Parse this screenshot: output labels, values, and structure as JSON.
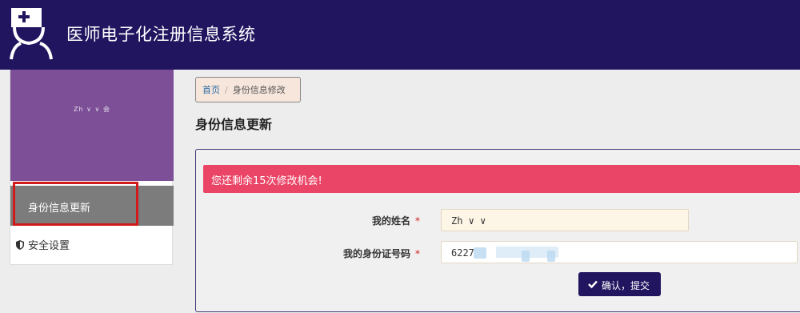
{
  "header": {
    "title": "医师电子化注册信息系统"
  },
  "sidebar": {
    "username": "Zh  ∨ ∨ 会",
    "items": [
      {
        "label": "身份信息更新",
        "active": true
      },
      {
        "label": "安全设置",
        "icon": "shield-icon"
      }
    ]
  },
  "breadcrumb": {
    "home": "首页",
    "current": "身份信息修改"
  },
  "page": {
    "title": "身份信息更新"
  },
  "alert": {
    "text": "您还剩余15次修改机会!"
  },
  "form": {
    "name_label": "我的姓名",
    "name_value": "Zh ∨ ∨",
    "id_label": "我的身份证号码",
    "id_value": "6227",
    "required_mark": "*",
    "submit_label": "确认，提交",
    "submit_icon": "check-icon"
  },
  "colors": {
    "brand": "#221560",
    "alert": "#ea4466",
    "sidebar_banner": "#7c4f96"
  }
}
